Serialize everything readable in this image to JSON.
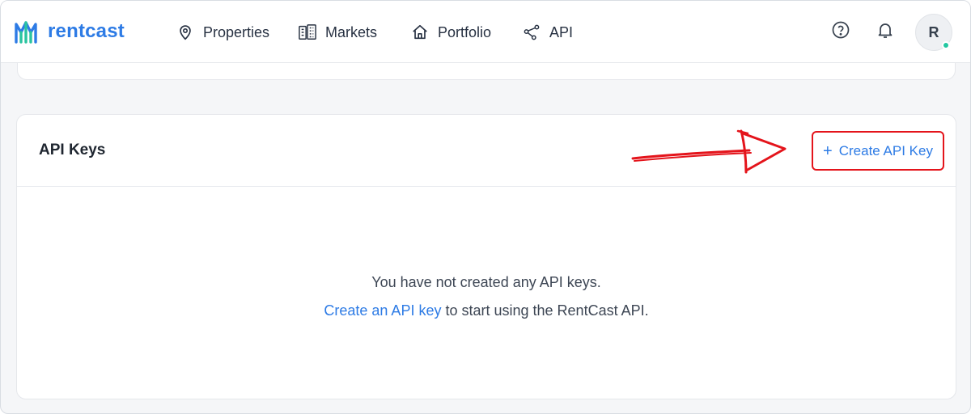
{
  "brand": {
    "name": "rentcast",
    "color": "#2d7be5"
  },
  "nav": {
    "items": [
      {
        "label": "Properties",
        "icon": "location-pin-icon"
      },
      {
        "label": "Markets",
        "icon": "buildings-icon"
      },
      {
        "label": "Portfolio",
        "icon": "home-icon"
      },
      {
        "label": "API",
        "icon": "network-nodes-icon"
      }
    ]
  },
  "header_actions": {
    "help_icon": "help-circle-icon",
    "notifications_icon": "bell-icon",
    "avatar_initial": "R",
    "status_color": "#22c7a1"
  },
  "api_keys": {
    "title": "API Keys",
    "create_button_label": "Create API Key",
    "create_icon": "plus-icon",
    "empty_message": "You have not created any API keys.",
    "empty_link_text": "Create an API key",
    "empty_suffix": " to start using the RentCast API."
  },
  "annotation": {
    "color": "#e4141b",
    "icon": "red-arrow-annotation"
  }
}
